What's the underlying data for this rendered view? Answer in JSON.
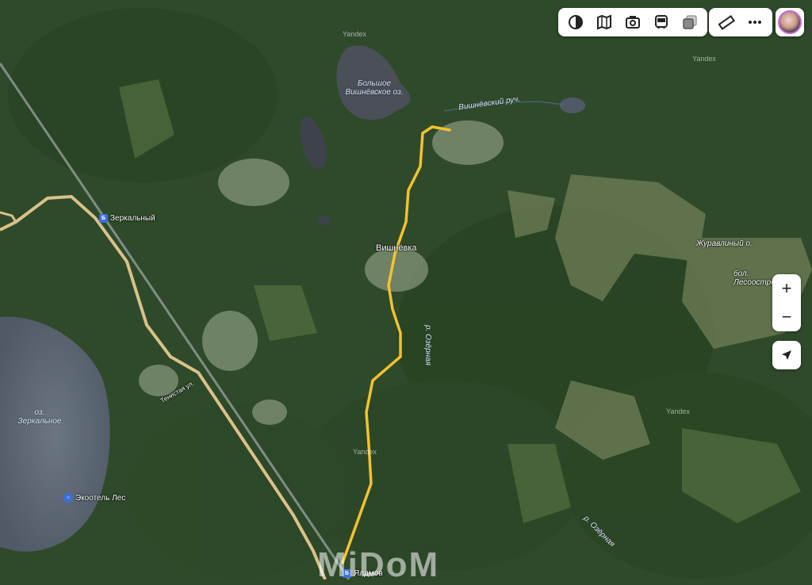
{
  "map": {
    "labels": {
      "lake_big": "Большое Вишнёвское оз.",
      "stream": "Вишнёвский руч.",
      "village": "Вишнёвка",
      "river_ozernaya_1": "р. Озёрная",
      "river_ozernaya_2": "р. Озёрная",
      "lake_zhuravliny": "Журавлиный о.",
      "bog": "бол. Лесоостровск",
      "lake_zerkalnoe": "оз. Зеркальное",
      "street": "Тенистая ул."
    },
    "pois": {
      "station_zerkalny": "Зеркальный",
      "station_yalamov": "Ялдмов",
      "ecohotel": "Экоотель Лес"
    },
    "watermark_provider": "Yandex",
    "site_watermark": "MiDoM"
  },
  "toolbar": {
    "layers": [
      "layers-icon",
      "panorama-map-icon",
      "camera-icon",
      "bus-icon",
      "stack-icon"
    ],
    "tools": [
      "ruler-icon",
      "more-icon"
    ]
  },
  "controls": {
    "zoom_in": "+",
    "zoom_out": "−"
  },
  "colors": {
    "route": "#f2c230",
    "road": "#d9c18a",
    "forest": "#2e4a28",
    "water": "#5e6b78"
  }
}
